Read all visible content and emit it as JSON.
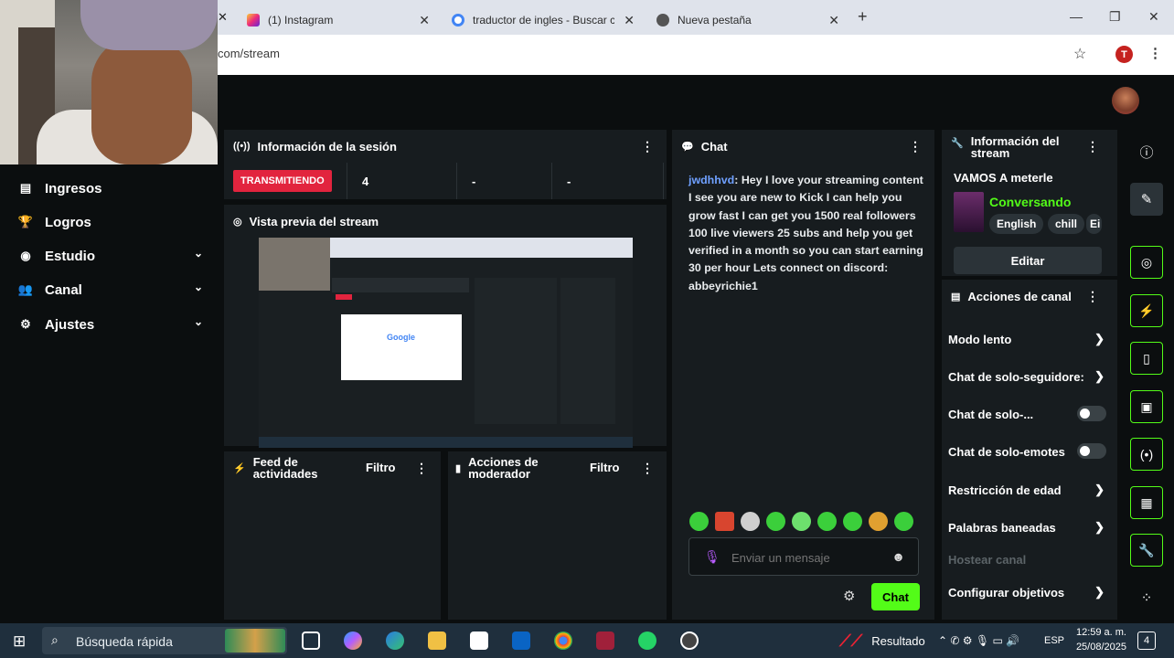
{
  "browser": {
    "tabs": [
      {
        "title": "(1) Instagram"
      },
      {
        "title": "traductor de ingles - Buscar co"
      },
      {
        "title": "Nueva pestaña"
      }
    ],
    "new_tab": "+",
    "address": "com/stream",
    "profile_initial": "T",
    "window_controls": {
      "minimize": "—",
      "maximize": "❐",
      "close": "✕"
    }
  },
  "sidebar": {
    "items": [
      {
        "label": "Ingresos",
        "icon": "ledger-icon",
        "glyph": "▤"
      },
      {
        "label": "Logros",
        "icon": "trophy-icon",
        "glyph": "🏆"
      },
      {
        "label": "Estudio",
        "icon": "studio-icon",
        "glyph": "◉",
        "chevron": "⌄"
      },
      {
        "label": "Canal",
        "icon": "users-icon",
        "glyph": "👥",
        "chevron": "⌄"
      },
      {
        "label": "Ajustes",
        "icon": "gear-icon",
        "glyph": "⚙",
        "chevron": "⌄"
      }
    ]
  },
  "session": {
    "title": "Información de la sesión",
    "live_badge": "TRANSMITIENDO",
    "stats": [
      "4",
      "-",
      "-"
    ]
  },
  "preview": {
    "title": "Vista previa del stream"
  },
  "activity": {
    "title": "Feed de actividades",
    "filter": "Filtro"
  },
  "moderator": {
    "title": "Acciones de moderador",
    "filter": "Filtro"
  },
  "chat": {
    "title": "Chat",
    "message": {
      "user": "jwdhhvd",
      "text": ": Hey I love your streaming content I see you are new to Kick I can help you grow fast I can get you 1500 real followers 100 live viewers 25 subs and help you get verified in a month so you can start earning 30 per hour Lets connect on discord: abbeyrichie1"
    },
    "input_placeholder": "Enviar un mensaje",
    "send_label": "Chat"
  },
  "stream_info": {
    "title": "Información del stream",
    "stream_title": "VAMOS A meterle",
    "category": "Conversando",
    "tags": [
      "English",
      "chill",
      "Ei"
    ],
    "edit_label": "Editar"
  },
  "channel_actions": {
    "title": "Acciones de canal",
    "items": [
      {
        "label": "Modo lento",
        "control": "arrow"
      },
      {
        "label": "Chat de solo-seguidore:",
        "control": "arrow"
      },
      {
        "label": "Chat de solo-...",
        "control": "toggle"
      },
      {
        "label": "Chat de solo-emotes",
        "control": "toggle"
      },
      {
        "label": "Restricción de edad",
        "control": "arrow"
      },
      {
        "label": "Palabras baneadas",
        "control": "arrow"
      },
      {
        "label": "Hostear canal",
        "control": "none"
      },
      {
        "label": "Configurar objetivos",
        "control": "arrow"
      }
    ]
  },
  "taskbar": {
    "search_placeholder": "Búsqueda rápida",
    "weather": "Resultado",
    "lang": "ESP",
    "time": "12:59 a. m.",
    "date": "25/08/2025",
    "notifications": "4"
  },
  "colors": {
    "accent": "#53fc18",
    "live": "#e2243e",
    "username": "#6fa0ff"
  }
}
